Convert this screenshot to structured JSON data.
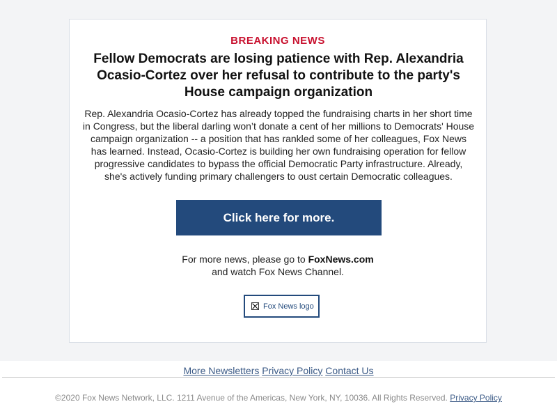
{
  "email": {
    "kicker": "BREAKING NEWS",
    "headline": "Fellow Democrats are losing patience with Rep. Alexandria Ocasio-Cortez over her refusal to contribute to the party's House campaign organization",
    "body": "Rep. Alexandria Ocasio-Cortez has already topped the fundraising charts in her short time in Congress, but the liberal darling won’t donate a cent of her millions to Democrats' House campaign organization -- a position that has rankled some of her colleagues, Fox News has learned. Instead, Ocasio-Cortez is building her own fundraising operation for fellow progressive candidates to bypass the official Democratic Party infrastructure. Already, she's actively funding primary challengers to oust certain Democratic colleagues.",
    "cta_label": "Click here for more.",
    "more_news_prefix": "For more news, please go to ",
    "more_news_site": "FoxNews.com",
    "more_news_suffix": "and watch Fox News Channel.",
    "logo_alt": "Fox News logo"
  },
  "footer": {
    "links": [
      "More Newsletters",
      "Privacy Policy",
      "Contact Us"
    ],
    "copyright": "©2020 Fox News Network, LLC. 1211 Avenue of the Americas, New York, NY, 10036. All Rights Reserved. ",
    "copyright_link": "Privacy Policy"
  },
  "colors": {
    "kicker": "#c8102e",
    "button": "#234a7c",
    "link": "#3b5a86"
  }
}
